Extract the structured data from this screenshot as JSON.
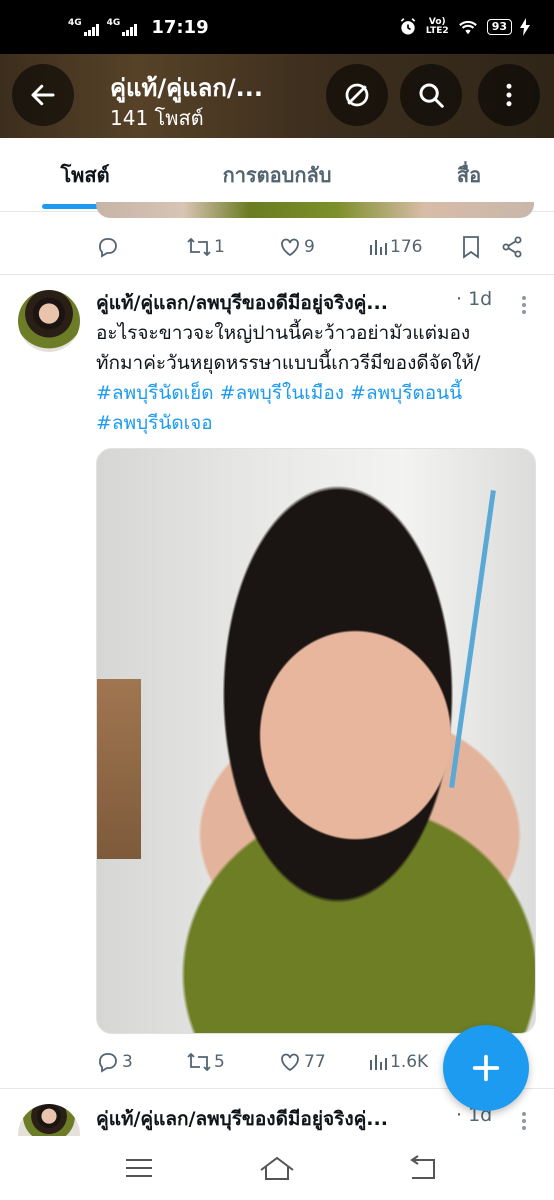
{
  "status_bar": {
    "net1": "4G",
    "net2": "4G",
    "time": "17:19",
    "volte": "Vo) LTE2",
    "volte_top": "Vo)",
    "volte_bottom": "LTE2",
    "battery": "93"
  },
  "header": {
    "title": "คู่แท้/คู่แลก/...",
    "post_count": "141 โพสต์",
    "icons": [
      "back-arrow-icon",
      "explore-off-icon",
      "search-icon",
      "more-vertical-icon"
    ]
  },
  "tabs": [
    {
      "label": "โพสต์",
      "active": true
    },
    {
      "label": "การตอบกลับ",
      "active": false
    },
    {
      "label": "สื่อ",
      "active": false
    }
  ],
  "prev_tweet": {
    "retweets": "1",
    "likes": "9",
    "views": "176"
  },
  "tweet": {
    "name": "คู่แท้/คู่แลก/ลพบุรีของดีมีอยู่จริงคู่...",
    "time": "· 1d",
    "text_lines": [
      "อะไรจะขาวจะใหญ่ปานนี้คะว้าวอย่ามัวแต่มอง",
      "ทักมาค่ะวันหยุดหรรษาแบบนี้เกวรีมีของดีจัดให้/"
    ],
    "hashtags_line1": "#ลพบุรีนัดเย็ด #ลพบุรีในเมือง #ลพบุรีตอนนี้",
    "hashtags_line2": "#ลพบุรีนัดเจอ",
    "replies": "3",
    "retweets": "5",
    "likes": "77",
    "views": "1.6K"
  },
  "next_tweet": {
    "name": "คู่แท้/คู่แลก/ลพบุรีของดีมีอยู่จริงคู่...",
    "time": "· 1d"
  },
  "colors": {
    "accent": "#1d9bf0",
    "secondary_text": "#536471",
    "header_bg": "#4a3923"
  }
}
